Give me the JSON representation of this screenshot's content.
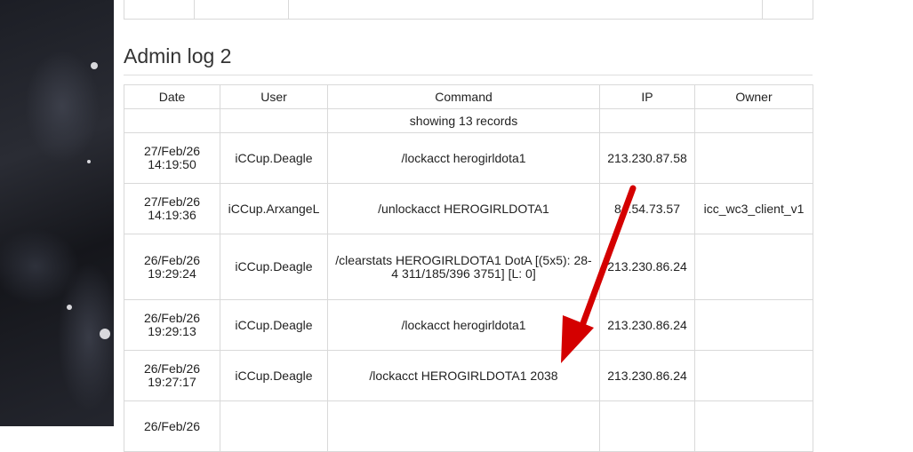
{
  "admin_log": {
    "title": "Admin log 2",
    "columns": {
      "date": "Date",
      "user": "User",
      "command": "Command",
      "ip": "IP",
      "owner": "Owner"
    },
    "records_info": "showing 13 records",
    "rows": [
      {
        "date": "27/Feb/26 14:19:50",
        "user": "iCCup.Deagle",
        "command": "/lockacct herogirldota1",
        "ip": "213.230.87.58",
        "owner": ""
      },
      {
        "date": "27/Feb/26 14:19:36",
        "user": "iCCup.ArxangeL",
        "command": "/unlockacct HEROGIRLDOTA1",
        "ip": "84.54.73.57",
        "owner": "icc_wc3_client_v1"
      },
      {
        "date": "26/Feb/26 19:29:24",
        "user": "iCCup.Deagle",
        "command": "/clearstats HEROGIRLDOTA1 DotA [(5x5): 28-4 311/185/396 3751] [L: 0]",
        "ip": "213.230.86.24",
        "owner": ""
      },
      {
        "date": "26/Feb/26 19:29:13",
        "user": "iCCup.Deagle",
        "command": "/lockacct herogirldota1",
        "ip": "213.230.86.24",
        "owner": ""
      },
      {
        "date": "26/Feb/26 19:27:17",
        "user": "iCCup.Deagle",
        "command": "/lockacct HEROGIRLDOTA1 2038",
        "ip": "213.230.86.24",
        "owner": ""
      },
      {
        "date": "26/Feb/26",
        "user": "",
        "command": "",
        "ip": "",
        "owner": ""
      }
    ]
  },
  "annotation": {
    "arrow_color": "#d40000"
  }
}
